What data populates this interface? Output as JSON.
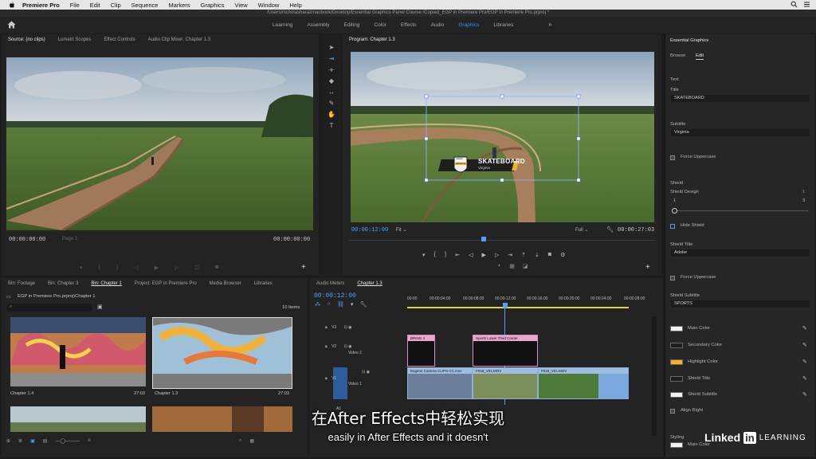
{
  "menubar": {
    "app": "Premiere Pro",
    "items": [
      "File",
      "Edit",
      "Clip",
      "Sequence",
      "Markers",
      "Graphics",
      "View",
      "Window",
      "Help"
    ]
  },
  "window": {
    "path": "/Users/nicholasharazmacbook/Desktop/Essential Graphics Panel Course /Copied_EGP in Premiere Pro/EGP in Premiere Pro.prproj *"
  },
  "workspaces": {
    "tabs": [
      "Learning",
      "Assembly",
      "Editing",
      "Color",
      "Effects",
      "Audio",
      "Graphics",
      "Libraries"
    ],
    "active": "Graphics",
    "more": "»"
  },
  "source": {
    "tabs": [
      "Source: (no clips)",
      "Lumetri Scopes",
      "Effect Controls",
      "Audio Clip Mixer: Chapter 1.3"
    ],
    "timecode_left": "00:00:00:00",
    "page": "Page 1",
    "timecode_right": "00:00:00:00"
  },
  "program": {
    "tab": "Program: Chapter 1.3",
    "timecode": "00:00:12:00",
    "fit": "Fit",
    "full": "Full",
    "duration": "00:00:27:03",
    "lower_third": {
      "title": "SKATEBOARD",
      "subtitle": "Virginia",
      "shield_title": "Adobe",
      "shield_subtitle": "SPORTS"
    }
  },
  "essential_graphics": {
    "header": "Essential Graphics",
    "tabs": [
      "Browse",
      "Edit"
    ],
    "section_text": "Text",
    "title_label": "Title",
    "title_value": "SKATEBOARD",
    "subtitle_label": "Subtitle",
    "subtitle_value": "Virginia",
    "force_uppercase_1": "Force Uppercase",
    "section_shield": "Shield",
    "shield_design_label": "Shield Design",
    "shield_design_value": "1",
    "shield_min": "1",
    "shield_max": "3",
    "hide_shield": "Hide Shield",
    "shield_title_label": "Shield Title",
    "shield_title_value": "Adobe",
    "force_uppercase_2": "Force Uppercase",
    "shield_subtitle_label": "Shield Subtitle",
    "shield_subtitle_value": "SPORTS",
    "colors": [
      {
        "label": "Main Color",
        "swatch": "#f2f2f2"
      },
      {
        "label": "Secondary Color",
        "swatch": "#1e1e1e"
      },
      {
        "label": "Highlight Color",
        "swatch": "#f0b323"
      },
      {
        "label": "Shield Title",
        "swatch": "#1e1e1e"
      },
      {
        "label": "Shield Subtitle",
        "swatch": "#f2f2f2"
      }
    ],
    "align_right": "Align Right",
    "section_styling": "Styling",
    "styling_main_color": "Main Color"
  },
  "bin": {
    "tabs": [
      "Bin: Footage",
      "Bin: Chapter 3",
      "Bin: Chapter 1",
      "Project: EGP in Premiere Pro",
      "Media Browser",
      "Libraries"
    ],
    "active": "Bin: Chapter 1",
    "path": "EGP in Premiere Pro.prproj\\Chapter 1",
    "count": "10 Items",
    "items": [
      {
        "name": "Chapter 1.4",
        "duration": "27:03"
      },
      {
        "name": "Chapter 1.3",
        "duration": "27:03"
      }
    ]
  },
  "timeline": {
    "tabs": [
      "Audio Meters",
      "Chapter 1.3"
    ],
    "timecode": "00:00:12:00",
    "ruler": [
      "00:00",
      "00:00:04:00",
      "00:00:08:00",
      "00:00:12:00",
      "00:00:16:00",
      "00:00:20:00",
      "00:00:24:00",
      "00:00:28:00"
    ],
    "tracks": [
      "V3",
      "V2",
      "V1",
      "A1"
    ],
    "track_names": {
      "v2": "Video 2",
      "v1": "Video 1"
    },
    "clips": {
      "v2_a": "BRING 4",
      "v2_b": "Sports Lower Third Center",
      "v1_a": "Eugene Camera CLIPS CC.mov",
      "v1_b": "F018_V01.MOV",
      "v1_c": "F019_V01.MOV"
    }
  },
  "captions": {
    "zh": "在After Effects中轻松实现",
    "en": "easily in After Effects and it doesn't"
  },
  "watermark": {
    "brand": "Linked",
    "in": "in",
    "learning": "LEARNING"
  }
}
